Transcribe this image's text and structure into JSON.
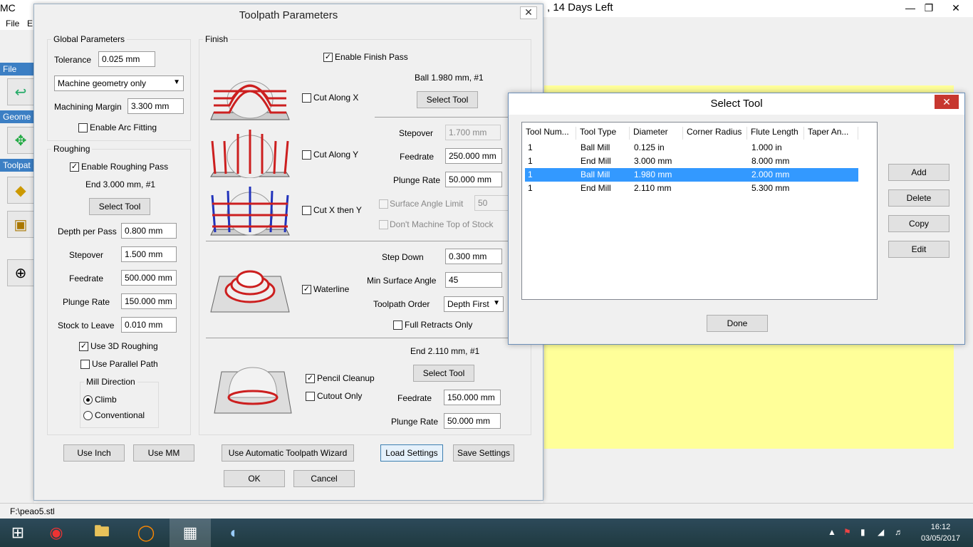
{
  "app": {
    "title": "MC",
    "trial_text": ", 14 Days Left",
    "menu": [
      "File",
      "E"
    ],
    "status": "F:\\peao5.stl"
  },
  "sidebar": {
    "file": "File",
    "geometry": "Geome",
    "toolpath": "Toolpat"
  },
  "dialog": {
    "title": "Toolpath Parameters",
    "global": {
      "legend": "Global Parameters",
      "tolerance_label": "Tolerance",
      "tolerance": "0.025 mm",
      "geometry_option": "Machine geometry only",
      "margin_label": "Machining Margin",
      "margin": "3.300 mm",
      "arc_label": "Enable Arc Fitting"
    },
    "roughing": {
      "legend": "Roughing",
      "enable_label": "Enable Roughing Pass",
      "tool": "End 3.000 mm, #1",
      "select_tool": "Select Tool",
      "depth_label": "Depth per Pass",
      "depth": "0.800 mm",
      "stepover_label": "Stepover",
      "stepover": "1.500 mm",
      "feed_label": "Feedrate",
      "feed": "500.000 mm",
      "plunge_label": "Plunge Rate",
      "plunge": "150.000 mm",
      "stock_label": "Stock to Leave",
      "stock": "0.010 mm",
      "use3d_label": "Use 3D Roughing",
      "parallel_label": "Use Parallel Path",
      "mill_legend": "Mill Direction",
      "climb": "Climb",
      "conventional": "Conventional"
    },
    "finish": {
      "legend": "Finish",
      "enable_label": "Enable Finish Pass",
      "tool": "Ball 1.980 mm, #1",
      "select_tool": "Select Tool",
      "cut_x": "Cut Along X",
      "cut_y": "Cut Along Y",
      "cut_xy": "Cut X then Y",
      "stepover_label": "Stepover",
      "stepover": "1.700 mm",
      "feed_label": "Feedrate",
      "feed": "250.000 mm",
      "plunge_label": "Plunge Rate",
      "plunge": "50.000 mm",
      "surface_limit_label": "Surface Angle Limit",
      "surface_limit": "50",
      "no_top_label": "Don't Machine Top of Stock",
      "waterline_label": "Waterline",
      "stepdown_label": "Step Down",
      "stepdown": "0.300 mm",
      "minangle_label": "Min Surface Angle",
      "minangle": "45",
      "order_label": "Toolpath Order",
      "order": "Depth First",
      "retracts_label": "Full Retracts Only",
      "pencil_tool": "End 2.110 mm, #1",
      "pencil_label": "Pencil Cleanup",
      "cutout_label": "Cutout Only",
      "pencil_select": "Select Tool",
      "pencil_feed_label": "Feedrate",
      "pencil_feed": "150.000 mm",
      "pencil_plunge_label": "Plunge Rate",
      "pencil_plunge": "50.000 mm"
    },
    "buttons": {
      "inch": "Use Inch",
      "mm": "Use MM",
      "wizard": "Use Automatic Toolpath Wizard",
      "load": "Load Settings",
      "save": "Save Settings",
      "ok": "OK",
      "cancel": "Cancel"
    }
  },
  "select_tool": {
    "title": "Select Tool",
    "columns": [
      "Tool Num...",
      "Tool Type",
      "Diameter",
      "Corner Radius",
      "Flute Length",
      "Taper An..."
    ],
    "rows": [
      [
        "1",
        "Ball Mill",
        "0.125 in",
        "",
        "1.000 in",
        ""
      ],
      [
        "1",
        "End Mill",
        "3.000 mm",
        "",
        "8.000 mm",
        ""
      ],
      [
        "1",
        "Ball Mill",
        "1.980 mm",
        "",
        "2.000 mm",
        ""
      ],
      [
        "1",
        "End Mill",
        "2.110 mm",
        "",
        "5.300 mm",
        ""
      ]
    ],
    "buttons": {
      "add": "Add",
      "delete": "Delete",
      "copy": "Copy",
      "edit": "Edit",
      "done": "Done"
    }
  },
  "taskbar": {
    "time": "16:12",
    "date": "03/05/2017"
  },
  "colors": {
    "accent": "#3399ff",
    "path_red": "#cc1f1f",
    "path_blue": "#2233bb"
  }
}
